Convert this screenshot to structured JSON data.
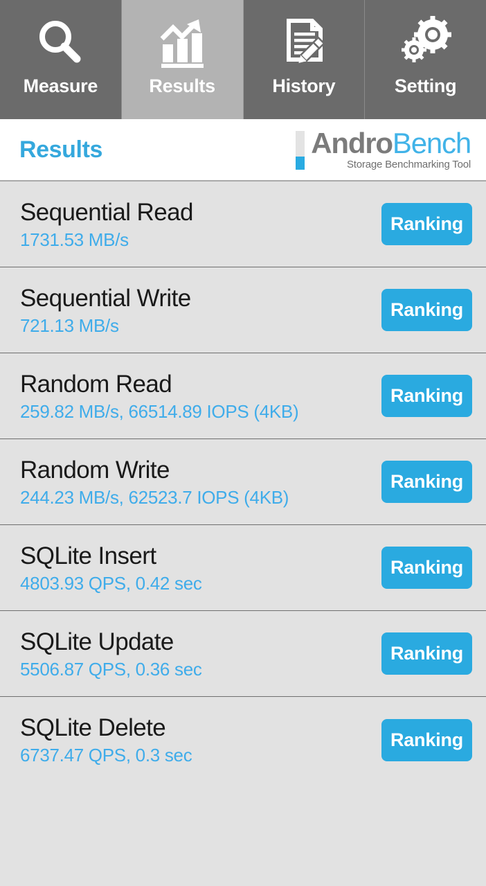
{
  "tabs": [
    {
      "label": "Measure",
      "icon": "magnifier-icon",
      "active": false
    },
    {
      "label": "Results",
      "icon": "bar-chart-arrow-icon",
      "active": true
    },
    {
      "label": "History",
      "icon": "document-pencil-icon",
      "active": false
    },
    {
      "label": "Setting",
      "icon": "gears-icon",
      "active": false
    }
  ],
  "header": {
    "title": "Results",
    "logo": {
      "word_primary": "Andro",
      "word_secondary": "Bench",
      "subtitle": "Storage Benchmarking Tool"
    }
  },
  "results": {
    "button_label": "Ranking",
    "rows": [
      {
        "title": "Sequential Read",
        "value": "1731.53 MB/s",
        "action": "Ranking"
      },
      {
        "title": "Sequential Write",
        "value": "721.13 MB/s",
        "action": "Ranking"
      },
      {
        "title": "Random Read",
        "value": "259.82 MB/s, 66514.89 IOPS (4KB)",
        "action": "Ranking"
      },
      {
        "title": "Random Write",
        "value": "244.23 MB/s, 62523.7 IOPS (4KB)",
        "action": "Ranking"
      },
      {
        "title": "SQLite Insert",
        "value": "4803.93 QPS, 0.42 sec",
        "action": "Ranking"
      },
      {
        "title": "SQLite Update",
        "value": "5506.87 QPS, 0.36 sec",
        "action": "Ranking"
      },
      {
        "title": "SQLite Delete",
        "value": "6737.47 QPS, 0.3 sec",
        "action": "Ranking"
      }
    ]
  },
  "colors": {
    "accent_blue": "#2aaae0",
    "value_blue": "#3facea",
    "title_blue": "#35a8dd",
    "tab_inactive": "#6b6b6b",
    "tab_active": "#b3b3b3",
    "list_bg": "#e2e2e2",
    "logo_gray": "#7b7b7b"
  }
}
